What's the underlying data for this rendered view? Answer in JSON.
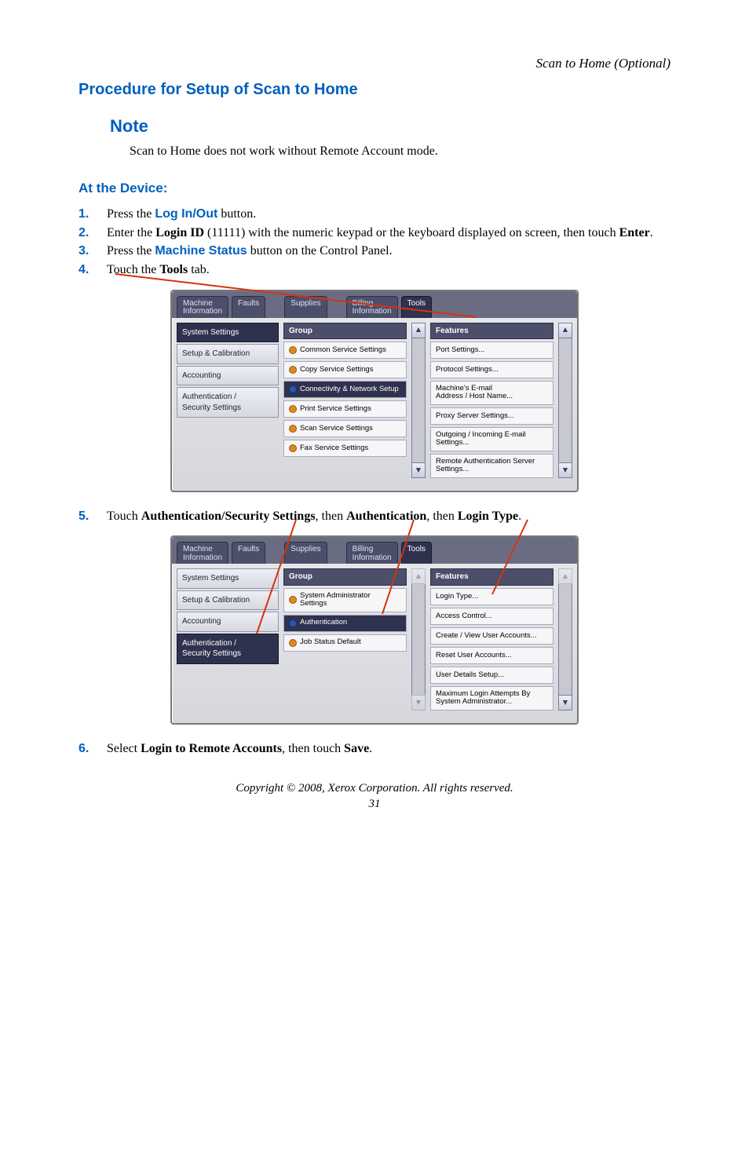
{
  "header_right": "Scan to Home (Optional)",
  "section_title": "Procedure for Setup of Scan to Home",
  "note_label": "Note",
  "note_text": "Scan to Home does not work without Remote Account mode.",
  "subsection": "At the Device:",
  "steps": {
    "s1_pre": "Press the ",
    "s1_blue": "Log In/Out",
    "s1_post": " button.",
    "s2_a": "Enter the ",
    "s2_b": "Login ID",
    "s2_c": " (11111) with the numeric keypad or the keyboard displayed on screen, then touch ",
    "s2_d": "Enter",
    "s2_e": ".",
    "s3_pre": "Press the ",
    "s3_blue": "Machine Status",
    "s3_post": " button on the Control Panel.",
    "s4_a": "Touch the ",
    "s4_b": "Tools",
    "s4_c": " tab.",
    "s5_a": "Touch ",
    "s5_b": "Authentication/Security Settings",
    "s5_c": ", then ",
    "s5_d": "Authentication",
    "s5_e": ", then ",
    "s5_f": "Login Type",
    "s5_g": ".",
    "s6_a": "Select ",
    "s6_b": "Login to Remote Accounts",
    "s6_c": ", then touch ",
    "s6_d": "Save",
    "s6_e": "."
  },
  "ss1": {
    "tabs": [
      "Machine\nInformation",
      "Faults",
      "Supplies",
      "Billing\nInformation",
      "Tools"
    ],
    "sidebar": [
      "System Settings",
      "Setup & Calibration",
      "Accounting",
      "Authentication /\nSecurity Settings"
    ],
    "group_head": "Group",
    "features_head": "Features",
    "group": [
      "Common Service Settings",
      "Copy Service Settings",
      "Connectivity & Network Setup",
      "Print Service Settings",
      "Scan Service Settings",
      "Fax Service Settings"
    ],
    "features": [
      "Port Settings...",
      "Protocol Settings...",
      "Machine's E-mail\nAddress / Host Name...",
      "Proxy Server Settings...",
      "Outgoing / Incoming E-mail\nSettings...",
      "Remote Authentication Server\nSettings..."
    ]
  },
  "ss2": {
    "tabs": [
      "Machine\nInformation",
      "Faults",
      "Supplies",
      "Billing\nInformation",
      "Tools"
    ],
    "sidebar": [
      "System Settings",
      "Setup & Calibration",
      "Accounting",
      "Authentication /\nSecurity Settings"
    ],
    "group_head": "Group",
    "features_head": "Features",
    "group": [
      "System Administrator\nSettings",
      "Authentication",
      "Job Status Default"
    ],
    "features": [
      "Login Type...",
      "Access Control...",
      "Create / View User Accounts...",
      "Reset User Accounts...",
      "User Details Setup...",
      "Maximum Login Attempts By\nSystem Administrator..."
    ]
  },
  "footer": "Copyright © 2008, Xerox Corporation. All rights reserved.",
  "pagenum": "31"
}
